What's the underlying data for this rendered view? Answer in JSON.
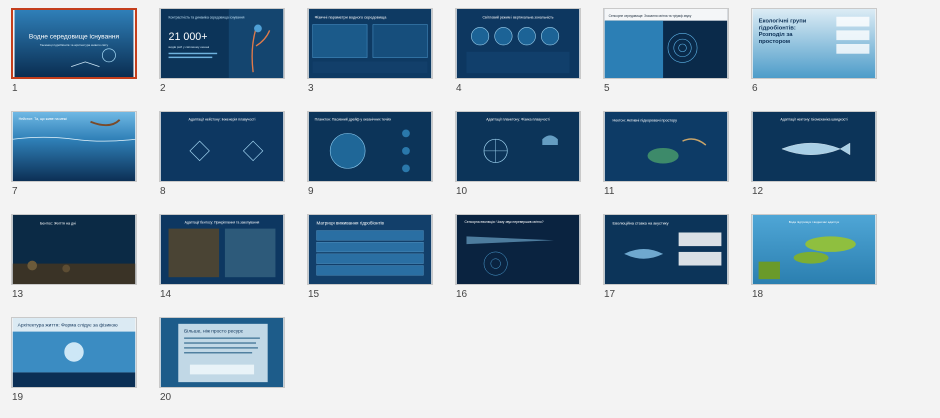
{
  "slides": [
    {
      "number": "1",
      "title": "Водне середовище існування",
      "subtitle": "Таємниці гідробіонтів та архітектура живого світу",
      "selected": true
    },
    {
      "number": "2",
      "title": "21 000+",
      "text": "Контрастність та динаміка середовища існування",
      "caption": "видів риб у світовому океані"
    },
    {
      "number": "3",
      "title": "Фізичні параметри водного середовища"
    },
    {
      "number": "4",
      "title": "Світловий режим і вертикальна зональність"
    },
    {
      "number": "5",
      "title": "Сенсорне середовище: Згасання світла та тріумф звуку"
    },
    {
      "number": "6",
      "title": "Екологічні групи гідробіонтів: Розподіл за простором"
    },
    {
      "number": "7",
      "title": "Нейстон: Та, що живе на межі"
    },
    {
      "number": "8",
      "title": "Адаптації нейстону: Інженерія плавучості"
    },
    {
      "number": "9",
      "title": "Планктон: Пасивний дрейф у океанічних течіях"
    },
    {
      "number": "10",
      "title": "Адаптації планктону: Фізика плавучості"
    },
    {
      "number": "11",
      "title": "Нектон: Активні підкорювачі простору"
    },
    {
      "number": "12",
      "title": "Адаптації нектону: Біомеханіка швидкості"
    },
    {
      "number": "13",
      "title": "Бентос: Життя на дні"
    },
    {
      "number": "14",
      "title": "Адаптації бентосу: Прикріплення та закопування"
    },
    {
      "number": "15",
      "title": "Матриця виживання гідробіонтів"
    },
    {
      "number": "16",
      "title": "Сенсорна еволюція: Чому звук перевершив світло?"
    },
    {
      "number": "17",
      "title": "Еволюційна ставка на акустику"
    },
    {
      "number": "18",
      "title": "Вода підтримує і водночас адаптує"
    },
    {
      "number": "19",
      "title": "Архітектура життя: Форма слідує за фізикою"
    },
    {
      "number": "20",
      "title": "Більше, ніж просто ресурс"
    }
  ],
  "colors": {
    "selection": "#c43e1c",
    "deep": "#0b2f55",
    "mid": "#1e5f8f",
    "light": "#3f8fc4"
  }
}
